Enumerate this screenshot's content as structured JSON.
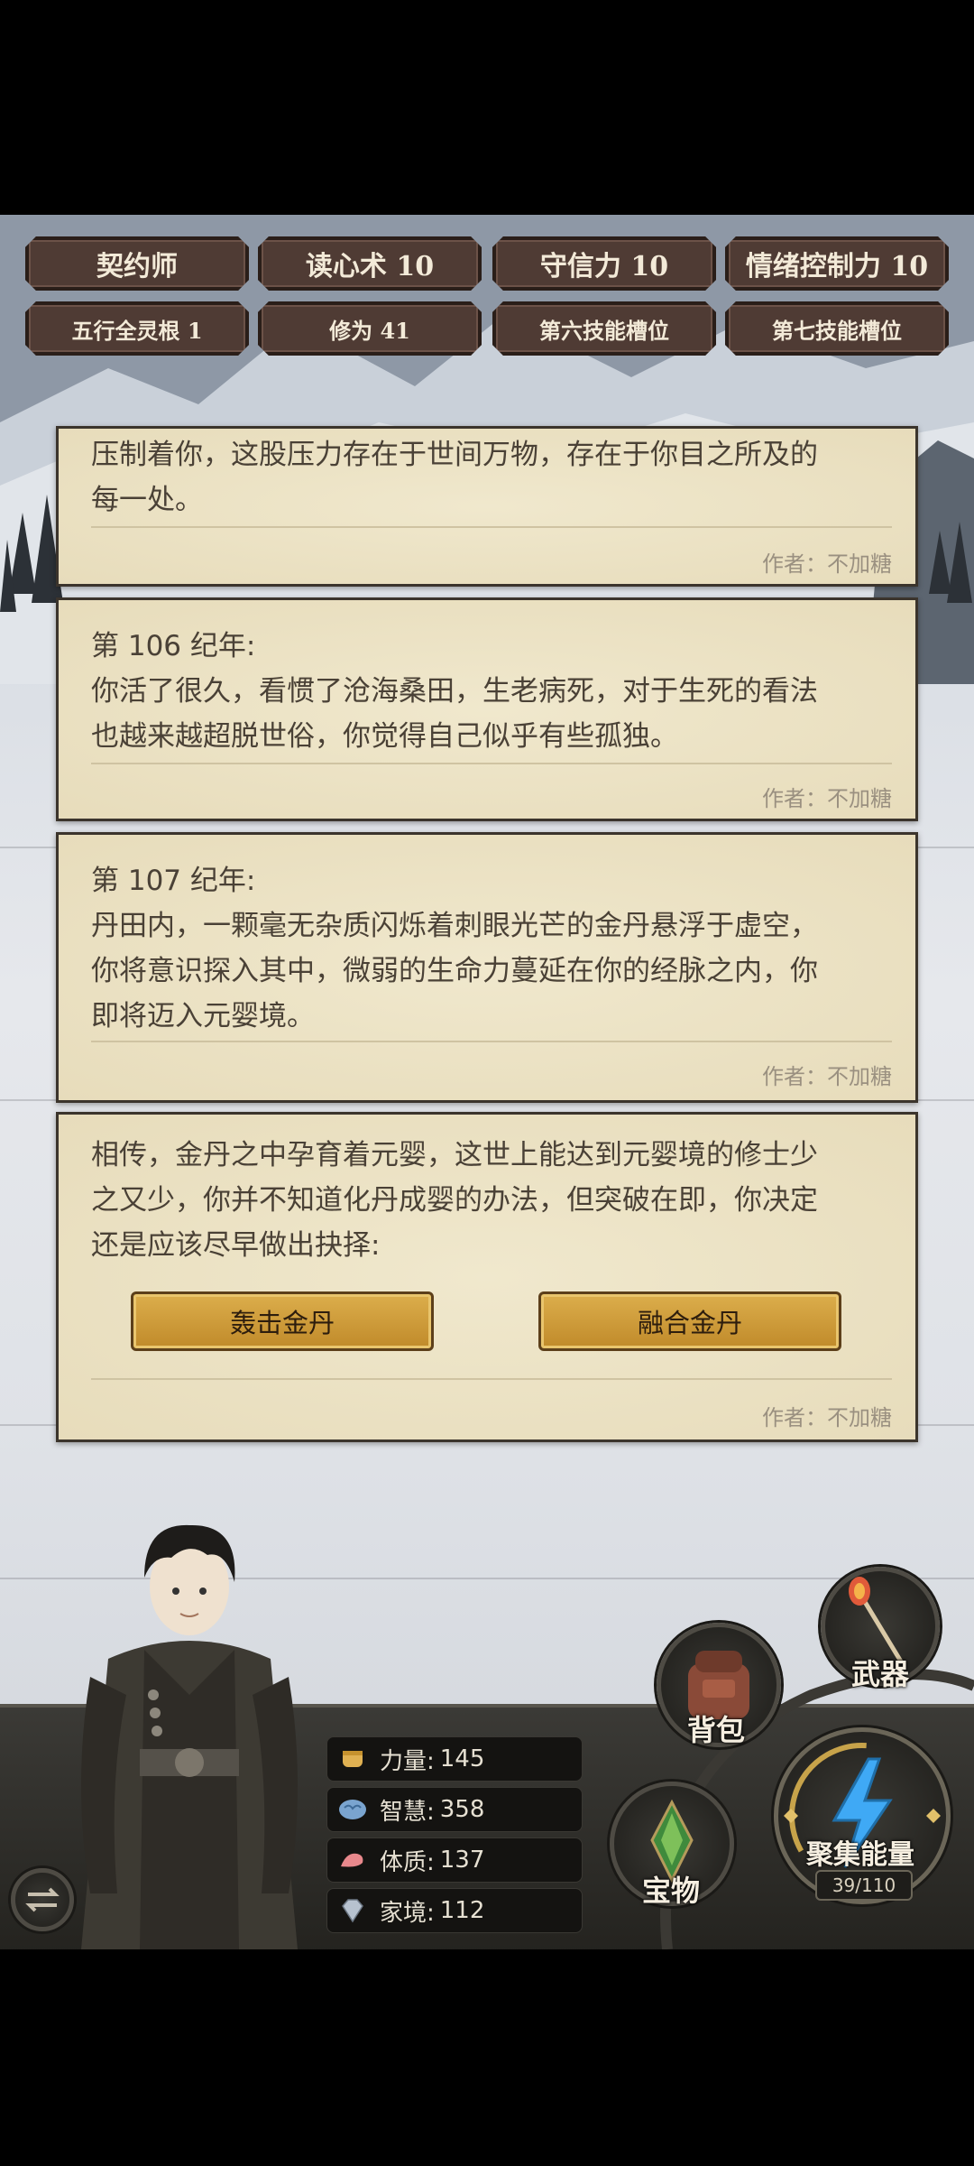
{
  "skills_row1": [
    "契约师",
    "读心术 10",
    "守信力 10",
    "情绪控制力 10"
  ],
  "skills_row2": [
    "五行全灵根 1",
    "修为 41",
    "第六技能槽位",
    "第七技能槽位"
  ],
  "cards": [
    {
      "lines": [
        "压制着你，这股压力存在于世间万物，存在于你目之所及的",
        "每一处。"
      ],
      "author": "作者：不加糖"
    },
    {
      "lines": [
        "第 106 纪年:",
        "你活了很久，看惯了沧海桑田，生老病死，对于生死的看法",
        "也越来越超脱世俗，你觉得自己似乎有些孤独。"
      ],
      "author": "作者：不加糖"
    },
    {
      "lines": [
        "第 107 纪年:",
        "丹田内，一颗毫无杂质闪烁着刺眼光芒的金丹悬浮于虚空，",
        "你将意识探入其中，微弱的生命力蔓延在你的经脉之内，你",
        "即将迈入元婴境。"
      ],
      "author": "作者：不加糖"
    },
    {
      "lines": [
        "相传，金丹之中孕育着元婴，这世上能达到元婴境的修士少",
        "之又少，你并不知道化丹成婴的办法，但突破在即，你决定",
        "还是应该尽早做出抉择:"
      ],
      "author": "作者：不加糖",
      "choices": [
        "轰击金丹",
        "融合金丹"
      ]
    }
  ],
  "stats": [
    {
      "label": "力量:",
      "value": "145",
      "icon": "fist-icon"
    },
    {
      "label": "智慧:",
      "value": "358",
      "icon": "brain-icon"
    },
    {
      "label": "体质:",
      "value": "137",
      "icon": "muscle-arm-icon"
    },
    {
      "label": "家境:",
      "value": "112",
      "icon": "diamond-icon"
    }
  ],
  "buttons": {
    "weapon": "武器",
    "backpack": "背包",
    "treasure": "宝物",
    "energy": "聚集能量",
    "energy_count": "39/110"
  },
  "colors": {
    "card_bg": "#ece3c5",
    "tag_bg": "#4f3b34",
    "choice_gold": "#d1a040",
    "energy_blue": "#3fa9f5"
  }
}
